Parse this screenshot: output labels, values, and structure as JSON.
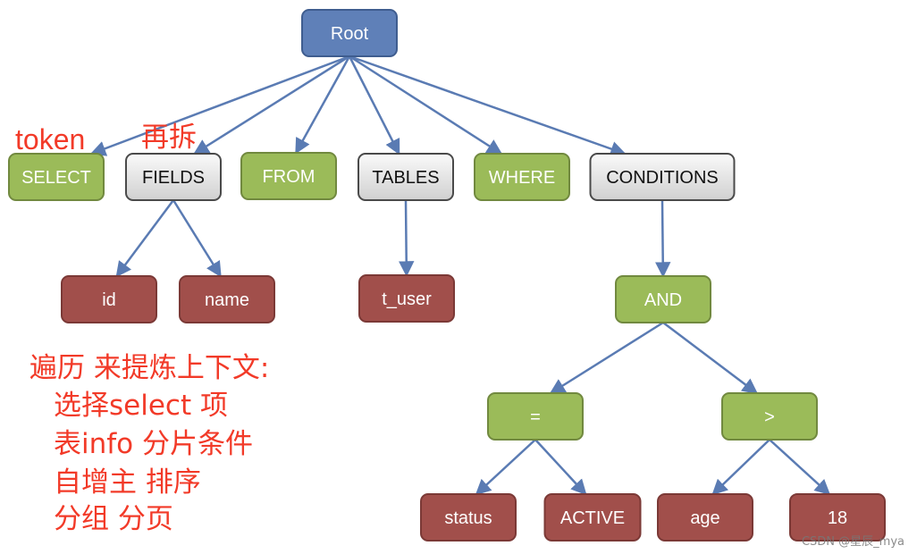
{
  "tree": {
    "nodes": [
      {
        "id": "root",
        "label": "Root",
        "kind": "blue"
      },
      {
        "id": "select",
        "label": "SELECT",
        "kind": "green",
        "parent": "root"
      },
      {
        "id": "fields",
        "label": "FIELDS",
        "kind": "gray",
        "parent": "root"
      },
      {
        "id": "from",
        "label": "FROM",
        "kind": "green",
        "parent": "root"
      },
      {
        "id": "tables",
        "label": "TABLES",
        "kind": "gray",
        "parent": "root"
      },
      {
        "id": "where",
        "label": "WHERE",
        "kind": "green",
        "parent": "root"
      },
      {
        "id": "conditions",
        "label": "CONDITIONS",
        "kind": "gray",
        "parent": "root"
      },
      {
        "id": "id",
        "label": "id",
        "kind": "red",
        "parent": "fields"
      },
      {
        "id": "name",
        "label": "name",
        "kind": "red",
        "parent": "fields"
      },
      {
        "id": "t_user",
        "label": "t_user",
        "kind": "red",
        "parent": "tables"
      },
      {
        "id": "and",
        "label": "AND",
        "kind": "green",
        "parent": "conditions"
      },
      {
        "id": "eq",
        "label": "=",
        "kind": "green",
        "parent": "and"
      },
      {
        "id": "gt",
        "label": ">",
        "kind": "green",
        "parent": "and"
      },
      {
        "id": "status",
        "label": "status",
        "kind": "red",
        "parent": "eq"
      },
      {
        "id": "active",
        "label": "ACTIVE",
        "kind": "red",
        "parent": "eq"
      },
      {
        "id": "age",
        "label": "age",
        "kind": "red",
        "parent": "gt"
      },
      {
        "id": "n18",
        "label": "18",
        "kind": "red",
        "parent": "gt"
      }
    ]
  },
  "colors": {
    "blue": "#5f80b8",
    "blue_border": "#3f5d8f",
    "green": "#9bbb59",
    "green_border": "#71893f",
    "red": "#a14f4b",
    "red_border": "#7b3936",
    "gray": "#e6e6e6",
    "gray_border": "#4a4a4a",
    "edge": "#5a7bb3",
    "annotation": "#f23a28"
  },
  "annotations": {
    "token": "token",
    "resplit": "再拆",
    "notes": [
      "遍历 来提炼上下文:",
      "选择select 项",
      "表info 分片条件",
      "自增主 排序",
      "分组 分页"
    ]
  },
  "watermark": "CSDN @星辰_mya"
}
